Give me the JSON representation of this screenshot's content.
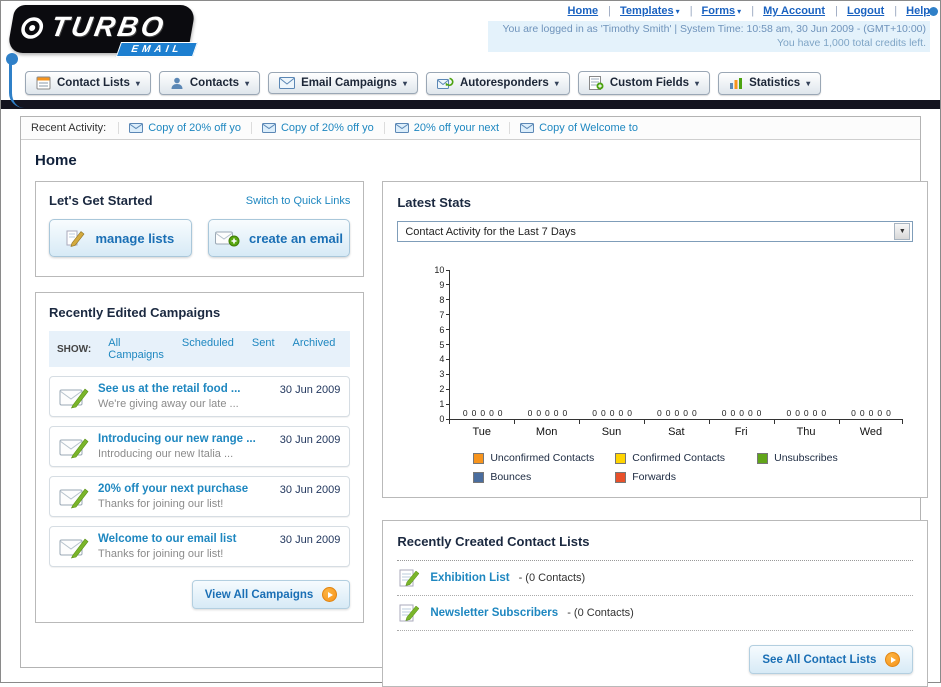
{
  "header": {
    "logo_title": "TURBO",
    "logo_subtitle": "EMAIL",
    "links": [
      {
        "label": "Home"
      },
      {
        "label": "Templates",
        "arrow": "▾"
      },
      {
        "label": "Forms",
        "arrow": "▾"
      },
      {
        "label": "My Account"
      },
      {
        "label": "Logout"
      },
      {
        "label": "Help"
      }
    ],
    "login_info": "You are logged in as 'Timothy Smith' | System Time: 10:58 am, 30 Jun 2009 - (GMT+10:00)",
    "credits": "You have 1,000 total credits left."
  },
  "nav_tabs": [
    {
      "label": "Contact Lists"
    },
    {
      "label": "Contacts"
    },
    {
      "label": "Email Campaigns"
    },
    {
      "label": "Autoresponders"
    },
    {
      "label": "Custom Fields"
    },
    {
      "label": "Statistics"
    }
  ],
  "recent_activity": {
    "label": "Recent Activity:",
    "items": [
      "Copy of 20% off yo",
      "Copy of 20% off yo",
      "20% off your next",
      "Copy of Welcome to"
    ]
  },
  "page_title": "Home",
  "get_started": {
    "title": "Let's Get Started",
    "switch_link": "Switch to Quick Links",
    "manage_lists_label": "manage lists",
    "create_email_label": "create an email"
  },
  "campaigns": {
    "title": "Recently Edited Campaigns",
    "show_label": "SHOW:",
    "tabs": [
      "All Campaigns",
      "Scheduled",
      "Sent",
      "Archived"
    ],
    "items": [
      {
        "title": "See us at the retail food ...",
        "subtitle": "We're giving away our late ...",
        "date": "30 Jun 2009"
      },
      {
        "title": "Introducing our new range ...",
        "subtitle": "Introducing our new Italia ...",
        "date": "30 Jun 2009"
      },
      {
        "title": "20% off your next purchase",
        "subtitle": "Thanks for joining our list!",
        "date": "30 Jun 2009"
      },
      {
        "title": "Welcome to our email list",
        "subtitle": "Thanks for joining our list!",
        "date": "30 Jun 2009"
      }
    ],
    "view_all_label": "View All Campaigns"
  },
  "stats": {
    "title": "Latest Stats",
    "dropdown_value": "Contact Activity for the Last 7 Days",
    "chart_data": {
      "type": "bar",
      "title": "Contact Activity for the Last 7 Days",
      "categories": [
        "Tue",
        "Mon",
        "Sun",
        "Sat",
        "Fri",
        "Thu",
        "Wed"
      ],
      "series": [
        {
          "name": "Unconfirmed Contacts",
          "color": "#f7941d",
          "values": [
            0,
            0,
            0,
            0,
            0,
            0,
            0
          ]
        },
        {
          "name": "Confirmed Contacts",
          "color": "#ffd400",
          "values": [
            0,
            0,
            0,
            0,
            0,
            0,
            0
          ]
        },
        {
          "name": "Unsubscribes",
          "color": "#61a519",
          "values": [
            0,
            0,
            0,
            0,
            0,
            0,
            0
          ]
        },
        {
          "name": "Bounces",
          "color": "#4a6d9e",
          "values": [
            0,
            0,
            0,
            0,
            0,
            0,
            0
          ]
        },
        {
          "name": "Forwards",
          "color": "#e8502a",
          "values": [
            0,
            0,
            0,
            0,
            0,
            0,
            0
          ]
        }
      ],
      "ylim": [
        0,
        10
      ],
      "y_tick_step": 1,
      "grid": false,
      "value_labels_shown": true,
      "legend_position": "bottom"
    }
  },
  "contact_lists": {
    "title": "Recently Created Contact Lists",
    "items": [
      {
        "name": "Exhibition List",
        "count": "- (0 Contacts)"
      },
      {
        "name": "Newsletter Subscribers",
        "count": "- (0 Contacts)"
      }
    ],
    "see_all_label": "See All Contact Lists"
  }
}
